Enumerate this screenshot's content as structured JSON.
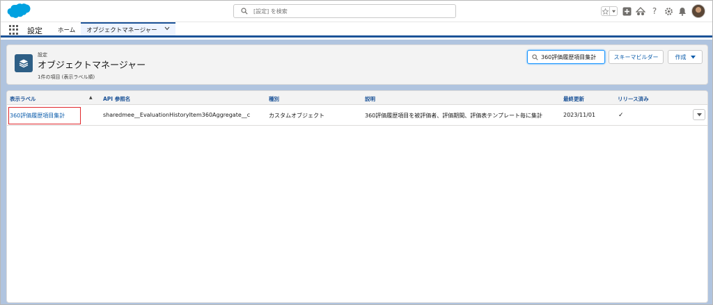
{
  "global_search": {
    "placeholder": "[設定] を検索"
  },
  "header_icons": [
    "favorites-star-icon",
    "favorites-list-icon",
    "add-icon",
    "trailhead-icon",
    "help-icon",
    "setup-gear-icon",
    "notifications-bell-icon",
    "avatar"
  ],
  "nav": {
    "app_name": "設定",
    "tabs": [
      {
        "label": "ホーム",
        "active": false
      },
      {
        "label": "オブジェクトマネージャー",
        "active": true
      }
    ]
  },
  "page_header": {
    "breadcrumb": "設定",
    "title": "オブジェクトマネージャー",
    "meta": "1件の項目 (表示ラベル順)",
    "quick_find_value": "360評価履歴項目集計",
    "schema_builder_label": "スキーマビルダー",
    "new_label": "作成"
  },
  "table": {
    "columns": [
      "表示ラベル",
      "API 参照名",
      "種別",
      "説明",
      "最終更新",
      "リリース済み"
    ],
    "rows": [
      {
        "label": "360評価履歴項目集計",
        "api_name": "sharedmee__EvaluationHistoryItem360Aggregate__c",
        "type": "カスタムオブジェクト",
        "description": "360評価履歴項目を被評価者、評価期間、評価表テンプレート毎に集計",
        "last_modified": "2023/11/01",
        "deployed": "✓"
      }
    ]
  },
  "colors": {
    "brand": "#1b5297",
    "link": "#0b5cab",
    "background": "#b0c4df",
    "highlight": "#e0262a",
    "object_icon": "#2e5f86"
  }
}
